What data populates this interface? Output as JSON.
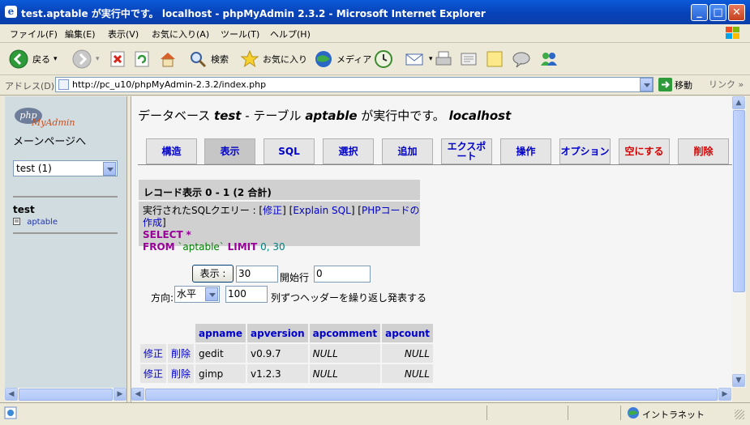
{
  "window": {
    "title": "test.aptable が実行中です。 localhost - phpMyAdmin 2.3.2 - Microsoft Internet Explorer",
    "icon_glyph": "e",
    "controls": {
      "minimize": "_",
      "maximize": "□",
      "close": "✕"
    }
  },
  "menubar": {
    "items": [
      "ファイル(F)",
      "編集(E)",
      "表示(V)",
      "お気に入り(A)",
      "ツール(T)",
      "ヘルプ(H)"
    ]
  },
  "toolbar": {
    "back_label": "戻る",
    "search_label": "検索",
    "favorites_label": "お気に入り",
    "media_label": "メディア",
    "dropdown_glyph": "▾",
    "icons": [
      "back-icon",
      "forward-icon",
      "stop-icon",
      "refresh-icon",
      "home-icon",
      "search-icon",
      "favorites-star-icon",
      "media-icon",
      "history-icon",
      "mail-icon",
      "print-icon",
      "edit-icon",
      "note-icon",
      "discuss-icon",
      "messenger-icon"
    ]
  },
  "addressbar": {
    "label": "アドレス(D)",
    "url": "http://pc_u10/phpMyAdmin-2.3.2/index.php",
    "go_label": "移動",
    "links_label": "リンク",
    "links_glyph": "»"
  },
  "left_frame": {
    "logo_php": "php",
    "logo_myadmin": "MyAdmin",
    "main_link": "メーンページへ",
    "db_select_value": "test (1)",
    "db_name": "test",
    "table_name": "aptable"
  },
  "right_frame": {
    "title": {
      "prefix": "データベース ",
      "db": "test",
      "mid": " - テーブル ",
      "table": "aptable",
      "suffix": " が実行中です。 ",
      "host": "localhost"
    },
    "tabs": [
      {
        "label": "構造",
        "state": "normal"
      },
      {
        "label": "表示",
        "state": "active"
      },
      {
        "label": "SQL",
        "state": "normal"
      },
      {
        "label": "選択",
        "state": "normal"
      },
      {
        "label": "追加",
        "state": "normal"
      },
      {
        "label": "エクスポート",
        "state": "normal"
      },
      {
        "label": "操作",
        "state": "normal"
      },
      {
        "label": "オプション",
        "state": "normal"
      },
      {
        "label": "空にする",
        "state": "danger"
      },
      {
        "label": "削除",
        "state": "danger"
      }
    ],
    "record_header": "レコード表示 0 - 1 (2 合計)",
    "sql": {
      "executed_label": "実行されたSQLクエリー : ",
      "edit_link": "修正",
      "explain_link": "Explain SQL",
      "php_link": "PHPコードの作成",
      "select_kw": "SELECT",
      "star": "*",
      "from_kw": "FROM",
      "table_ref": "`aptable`",
      "limit_kw": "LIMIT",
      "limit_values": "0, 30"
    },
    "nav_form": {
      "show_button": "表示 :",
      "rows_value": "30",
      "start_label": "開始行",
      "start_value": "0",
      "direction_label": "方向:",
      "direction_value": "水平",
      "repeat_value": "100",
      "repeat_label": "列ずつヘッダーを繰り返し発表する"
    },
    "table": {
      "columns": [
        "apname",
        "apversion",
        "apcomment",
        "apcount"
      ],
      "action_edit": "修正",
      "action_delete": "削除",
      "rows": [
        [
          "gedit",
          "v0.9.7",
          "NULL",
          "NULL"
        ],
        [
          "gimp",
          "v1.2.3",
          "NULL",
          "NULL"
        ]
      ]
    }
  },
  "statusbar": {
    "text": "",
    "zone_label": "イントラネット"
  }
}
